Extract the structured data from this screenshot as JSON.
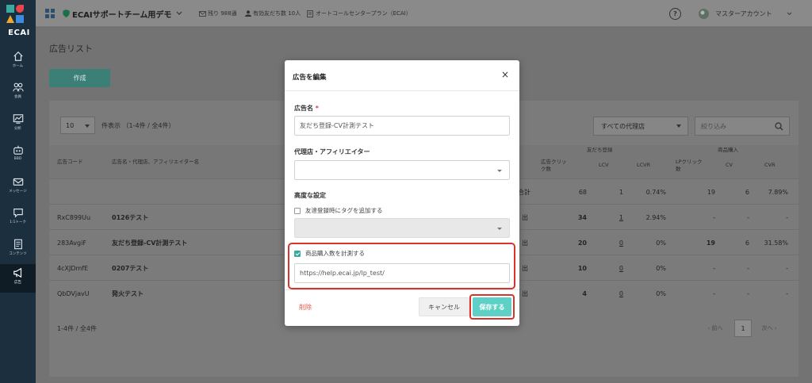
{
  "app": {
    "logo_text": "ECAI"
  },
  "sidebar": {
    "items": [
      {
        "label": "ホーム",
        "icon": "home-icon"
      },
      {
        "label": "会員",
        "icon": "members-icon"
      },
      {
        "label": "分析",
        "icon": "chart-icon"
      },
      {
        "label": "BBD",
        "icon": "bot-icon"
      },
      {
        "label": "メッセージ",
        "icon": "message-icon"
      },
      {
        "label": "1:1トーク",
        "icon": "chat-icon"
      },
      {
        "label": "コンテンツ",
        "icon": "content-icon"
      },
      {
        "label": "広告",
        "icon": "megaphone-icon",
        "active": true
      }
    ]
  },
  "header": {
    "workspace": "ECAIサポートチーム用デモ",
    "remaining": "残り 988通",
    "friends": "有効友だち数 10人",
    "plan": "オートコールセンタープラン（ECAI）",
    "account": "マスターアカウント"
  },
  "page": {
    "title": "広告リスト",
    "create_button": "作成",
    "per_page": "10",
    "per_page_text": "件表示 （1-4件 / 全4件）",
    "agency_filter": "すべての代理店",
    "search_placeholder": "絞り込み",
    "table": {
      "headers": {
        "ad_code": "広告コード",
        "ad_name": "広告名・代理店、アフィリエイター名",
        "friend_group": "友だち登録",
        "purchase_group": "商品購入",
        "click_1": "広告クリッ",
        "click_2": "ク数",
        "lcv": "LCV",
        "lcvr": "LCVR",
        "lp_1": "LPクリック",
        "lp_2": "数",
        "cv": "CV",
        "cvr": "CVR"
      },
      "total": {
        "label": "合計",
        "clicks": "68",
        "lcv": "1",
        "lcvr": "0.74%",
        "lp": "19",
        "cv": "6",
        "cvr": "7.89%"
      },
      "rows": [
        {
          "code": "RxC899Uu",
          "name": "0126テスト",
          "btn": "出",
          "clicks": "34",
          "lcv": "1",
          "lcvr": "2.94%",
          "lp": "-",
          "cv": "-",
          "cvr": "-"
        },
        {
          "code": "283AvgiF",
          "name": "友だち登録-CV計測テスト",
          "btn": "出",
          "clicks": "20",
          "lcv": "0",
          "lcvr": "0%",
          "lp": "19",
          "cv": "6",
          "cvr": "31.58%"
        },
        {
          "code": "4cXJDmfE",
          "name": "0207テスト",
          "btn": "出",
          "clicks": "10",
          "lcv": "0",
          "lcvr": "0%",
          "lp": "-",
          "cv": "-",
          "cvr": "-"
        },
        {
          "code": "QbDVjavU",
          "name": "発火テスト",
          "btn": "出",
          "clicks": "4",
          "lcv": "0",
          "lcvr": "0%",
          "lp": "-",
          "cv": "-",
          "cvr": "-"
        }
      ]
    },
    "footer_count": "1-4件 / 全4件",
    "pager": {
      "prev": "‹ 前へ",
      "current": "1",
      "next": "次へ ›"
    }
  },
  "modal": {
    "title": "広告を編集",
    "close": "×",
    "ad_name_label": "広告名",
    "required_mark": "*",
    "ad_name_value": "友だち登録-CV計測テスト",
    "agency_label": "代理店・アフィリエイター",
    "agency_value": "",
    "advanced_label": "高度な設定",
    "tag_checkbox_label": "友達登録時にタグを追加する",
    "purchase_checkbox_label": "商品購入数を計測する",
    "purchase_url": "https://help.ecai.jp/lp_test/",
    "delete": "削除",
    "cancel": "キャンセル",
    "save": "保存する"
  },
  "colors": {
    "accent": "#3aa9a0",
    "save_button": "#5ed0c5",
    "highlight": "#d9342b",
    "sidebar": "#1b2f3f"
  }
}
